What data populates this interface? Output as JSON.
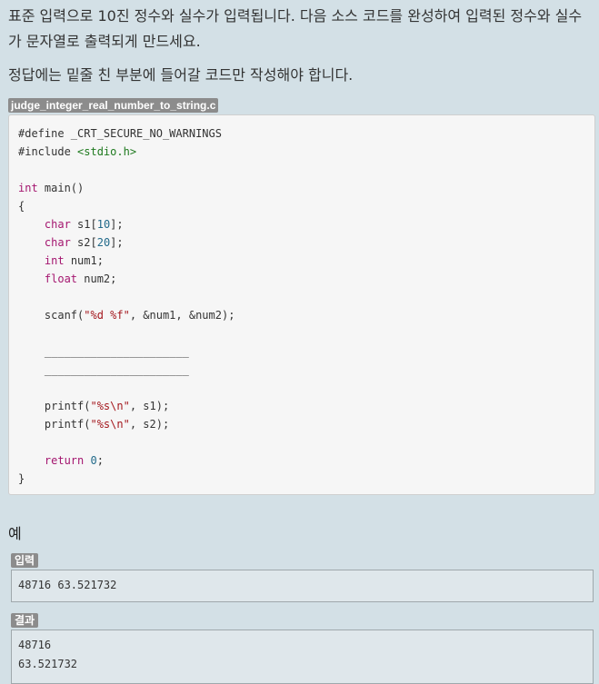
{
  "problem": {
    "description": "표준 입력으로 10진 정수와 실수가 입력됩니다. 다음 소스 코드를 완성하여 입력된 정수와 실수가 문자열로 출력되게 만드세요.",
    "instruction": "정답에는 밑줄 친 부분에 들어갈 코드만 작성해야 합니다."
  },
  "code_file": {
    "filename": "judge_integer_real_number_to_string.c",
    "lines": [
      "#define _CRT_SECURE_NO_WARNINGS",
      "#include <stdio.h>",
      "",
      "int main()",
      "{",
      "    char s1[10];",
      "    char s2[20];",
      "    int num1;",
      "    float num2;",
      "",
      "    scanf(\"%d %f\", &num1, &num2);",
      "",
      "    ______________________",
      "    ______________________",
      "",
      "    printf(\"%s\\n\", s1);",
      "    printf(\"%s\\n\", s2);",
      "",
      "    return 0;",
      "}"
    ]
  },
  "example": {
    "title": "예",
    "input_label": "입력",
    "input_lines": [
      "48716 63.521732"
    ],
    "output_label": "결과",
    "output_lines": [
      "48716",
      "63.521732"
    ]
  },
  "colors": {
    "background": "#d3e0e6",
    "keyword": "#a4166f",
    "string": "#a4181e",
    "number": "#226a8a",
    "include_path": "#1f7a1f",
    "badge": "#8c8c8c"
  }
}
